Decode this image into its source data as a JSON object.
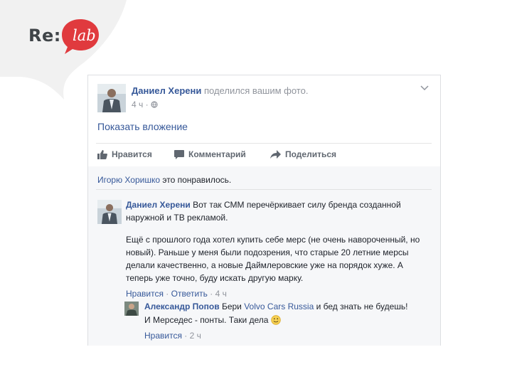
{
  "logo": {
    "re": "Re:",
    "lab": "lab"
  },
  "post": {
    "author": "Даниел Херени",
    "action": "поделился вашим фото.",
    "time": "4 ч",
    "show_attachment": "Показать вложение",
    "actions": {
      "like": "Нравится",
      "comment": "Комментарий",
      "share": "Поделиться"
    }
  },
  "likes": {
    "user": "Игорю Хоришко",
    "text": "это понравилось."
  },
  "comment": {
    "author": "Даниел Херени",
    "line1": "Вот так СММ перечёркивает силу бренда созданной наружной и ТВ рекламой.",
    "paragraph2": "Ещё с прошлого года хотел купить себе мерс (не очень навороченный, но новый). Раньше у меня были подозрения, что старые 20 летние мерсы делали качественно, а новые Даймлеровские уже на порядок хуже. А теперь уже точно, буду искать другую марку.",
    "like_label": "Нравится",
    "reply_label": "Ответить",
    "time": "4 ч"
  },
  "reply": {
    "author": "Александр Попов",
    "text_before": "Бери",
    "brand": "Volvo Cars Russia",
    "text_after": "и бед знать не будешь!",
    "line2": "И Мерседес - понты. Таки дела",
    "like_label": "Нравится",
    "time": "2 ч"
  },
  "colors": {
    "link": "#365899",
    "meta": "#90949c",
    "logo_red": "#e03a3e",
    "card_border": "#dddfe2"
  },
  "icons": [
    "thumbs-up-icon",
    "comment-icon",
    "share-arrow-icon",
    "globe-icon",
    "chevron-down-icon",
    "smile-emoji-icon"
  ]
}
